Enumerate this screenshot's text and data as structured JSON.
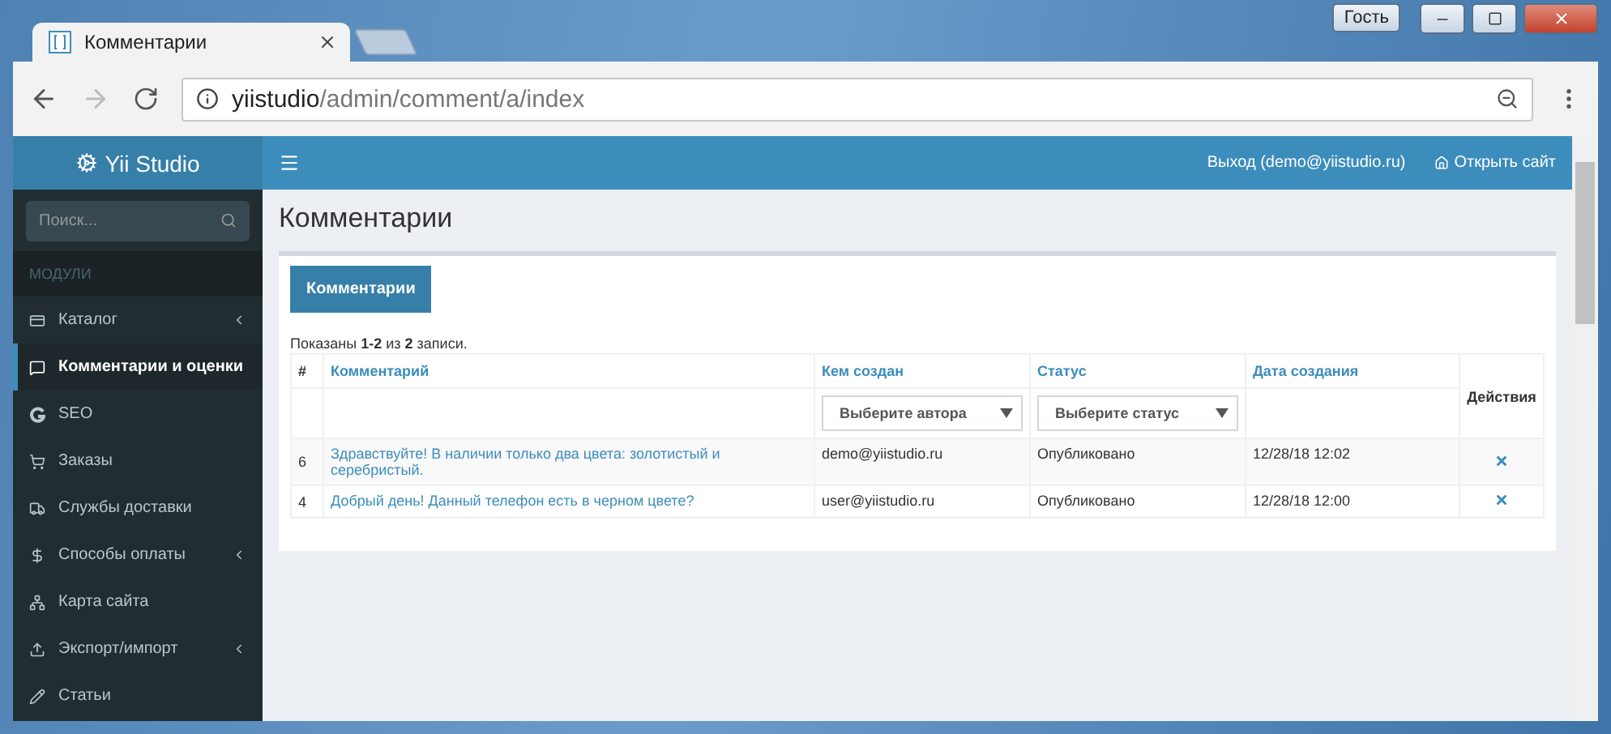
{
  "browser": {
    "guest_label": "Гость",
    "tab": {
      "title": "Комментарии"
    },
    "url_host": "yiistudio",
    "url_path": "/admin/comment/a/index"
  },
  "header": {
    "brand": "Yii Studio",
    "logout": "Выход (demo@yiistudio.ru)",
    "open_site": "Открыть сайт"
  },
  "sidebar": {
    "search": {
      "placeholder": "Поиск..."
    },
    "section": "МОДУЛИ",
    "items": [
      {
        "label": "Каталог",
        "selected": false,
        "expandable": true
      },
      {
        "label": "Комментарии и оценки",
        "selected": true,
        "expandable": false
      },
      {
        "label": "SEO",
        "selected": false,
        "expandable": false
      },
      {
        "label": "Заказы",
        "selected": false,
        "expandable": false
      },
      {
        "label": "Службы доставки",
        "selected": false,
        "expandable": false
      },
      {
        "label": "Способы оплаты",
        "selected": false,
        "expandable": true
      },
      {
        "label": "Карта сайта",
        "selected": false,
        "expandable": false
      },
      {
        "label": "Экспорт/импорт",
        "selected": false,
        "expandable": true
      },
      {
        "label": "Статьи",
        "selected": false,
        "expandable": false
      }
    ]
  },
  "page": {
    "title": "Комментарии",
    "create_button": "Комментарии",
    "summary": "Показаны **1-2** из **2** записи.",
    "table": {
      "columns": [
        "#",
        "Комментарий",
        "Кем создан",
        "Статус",
        "Дата создания",
        "Действия"
      ],
      "filters": {
        "author": {
          "placeholder": "Выберите автора"
        },
        "status": {
          "placeholder": "Выберите статус"
        }
      },
      "rows": [
        {
          "id": "6",
          "comment": "Здравствуйте! В наличии только два цвета: золотистый и серебристый.",
          "author": "demo@yiistudio.ru",
          "status": "Опубликовано",
          "date": "12/28/18 12:02"
        },
        {
          "id": "4",
          "comment": "Добрый день! Данный телефон есть в черном цвете?",
          "author": "user@yiistudio.ru",
          "status": "Опубликовано",
          "date": "12/28/18 12:00"
        }
      ]
    }
  }
}
